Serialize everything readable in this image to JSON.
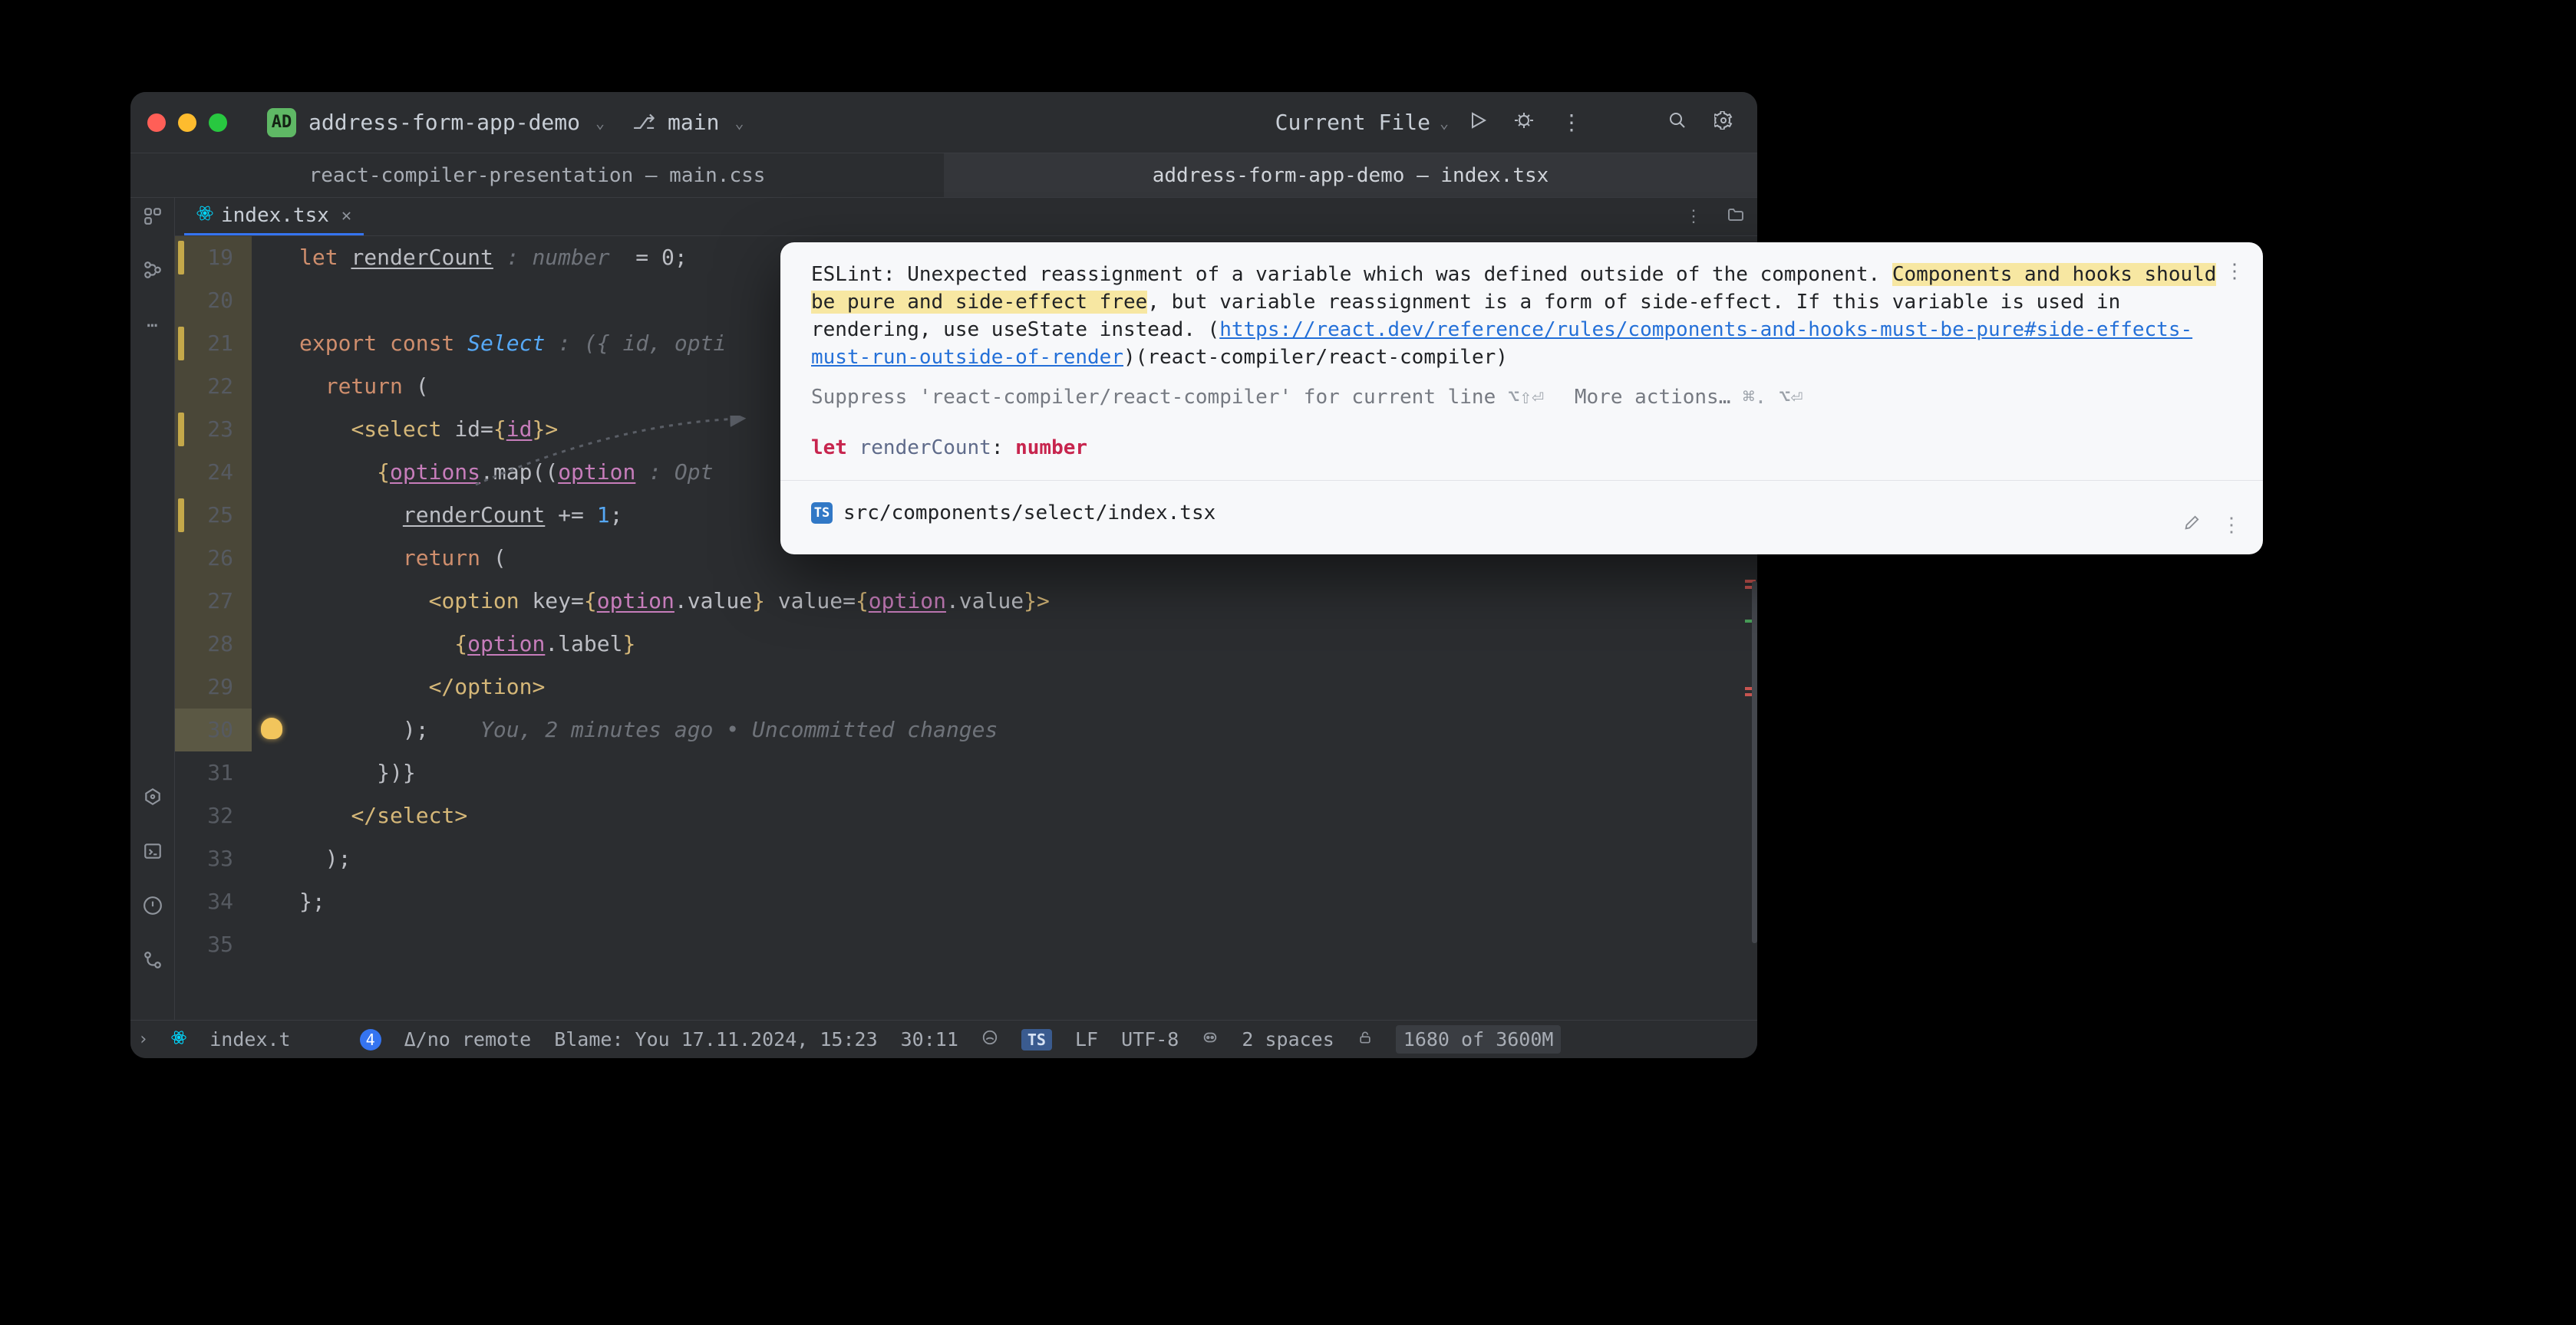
{
  "titlebar": {
    "project_badge": "AD",
    "project_name": "address-form-app-demo",
    "branch": "main",
    "run_config": "Current File"
  },
  "sub_tabs": {
    "left": "react-compiler-presentation – main.css",
    "right": "address-form-app-demo – index.tsx"
  },
  "file_tab": {
    "name": "index.tsx"
  },
  "gutter": {
    "start": 19,
    "end": 35,
    "modified": [
      19,
      21,
      23,
      25
    ]
  },
  "code": {
    "l19": {
      "kw": "let",
      "id": "renderCount",
      "typ": " : number",
      "rest": "  = 0;"
    },
    "l20": "",
    "l21": {
      "kw": "export const",
      "id": "Select",
      "rest": " : ({ id, opti"
    },
    "l22": {
      "kw": "return",
      "rest": " ("
    },
    "l23": {
      "open": "<",
      "tag": "select",
      "attr": "id",
      "br_eq": "=",
      "id": "id",
      "close": ">"
    },
    "l24": {
      "open": "{",
      "id": "options",
      "method": ".map(",
      "arrow": "(",
      "param": "option",
      "hint": " : Opt"
    },
    "l25": {
      "id": "renderCount",
      "op": " += ",
      "num": "1",
      "semi": ";"
    },
    "l26": {
      "kw": "return",
      "rest": " ("
    },
    "l27": {
      "open": "<",
      "tag": "option",
      "key": "key",
      "eqL": "=",
      "id1": "option",
      "val": ".value",
      "sp": " ",
      "valueAttr": "value",
      "eqR": "=",
      "id2": "option",
      "close": ">"
    },
    "l28": {
      "open": "{",
      "id": "option",
      "prop": ".label",
      "close": "}"
    },
    "l29": {
      "open": "</",
      "tag": "option",
      "close": ">"
    },
    "l30": {
      "paren": ");",
      "blame": "You, 2 minutes ago • Uncommitted changes"
    },
    "l31": {
      "text": "})}"
    },
    "l32": {
      "open": "</",
      "tag": "select",
      "close": ">"
    },
    "l33": {
      "paren": ");"
    },
    "l34": {
      "paren": "};"
    },
    "l35": ""
  },
  "popover": {
    "prefix": "ESLint: Unexpected reassignment of a variable which was defined outside of the component. ",
    "hl": "Components and hooks should be pure and side-effect free",
    "mid": ", but variable reassignment is a form of side-effect. If this variable is used in rendering, use useState instead. (",
    "link": "https://react.dev/reference/rules/components-and-hooks-must-be-pure#side-effects-must-run-outside-of-render",
    "suffix": ")(react-compiler/react-compiler)",
    "suppress": "Suppress 'react-compiler/react-compiler' for current line",
    "suppress_shortcut": "⌥⇧⏎",
    "more": "More actions…",
    "more_shortcut": "⌘.  ⌥⏎",
    "decl_let": "let ",
    "decl_name": "renderCount",
    "decl_colon": ": ",
    "decl_type": "number",
    "path": "src/components/select/index.tsx"
  },
  "status": {
    "file_crumb": "index.t",
    "err_count": "4",
    "remote": "Δ/no remote",
    "blame": "Blame: You 17.11.2024, 15:23",
    "cursor": "30:11",
    "ts_badge": "TS",
    "eol": "LF",
    "encoding": "UTF-8",
    "indent": "2 spaces",
    "memory": "1680 of 3600M"
  }
}
